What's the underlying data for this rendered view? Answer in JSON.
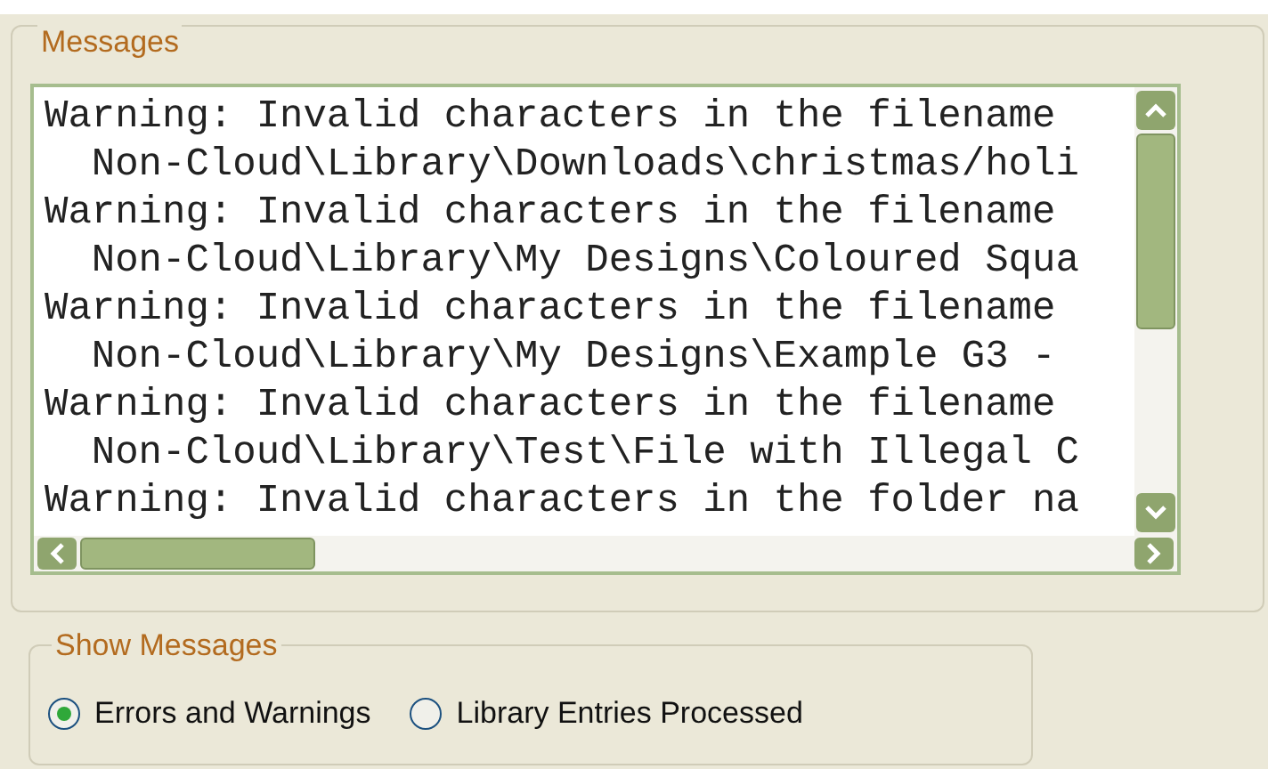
{
  "messages_group": {
    "title": "Messages",
    "lines": [
      "Warning: Invalid characters in the filename",
      "  Non-Cloud\\Library\\Downloads\\christmas/holi",
      "Warning: Invalid characters in the filename",
      "  Non-Cloud\\Library\\My Designs\\Coloured Squa",
      "Warning: Invalid characters in the filename",
      "  Non-Cloud\\Library\\My Designs\\Example G3 -",
      "Warning: Invalid characters in the filename",
      "  Non-Cloud\\Library\\Test\\File with Illegal C",
      "Warning: Invalid characters in the folder na"
    ]
  },
  "show_messages": {
    "title": "Show Messages",
    "options": [
      {
        "label": "Errors and Warnings",
        "selected": true
      },
      {
        "label": "Library Entries Processed",
        "selected": false
      }
    ]
  }
}
